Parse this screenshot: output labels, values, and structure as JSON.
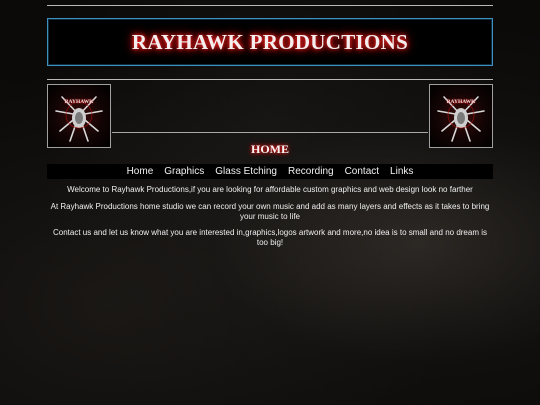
{
  "site": {
    "title": "RAYHAWK PRODUCTIONS",
    "accent_glow": "#d01010",
    "banner_border": "#3d90c0"
  },
  "logos": {
    "left": {
      "text": "RAYHAWK",
      "icon": "rayhawk-emblem"
    },
    "right": {
      "text": "RAYHAWK",
      "icon": "rayhawk-emblem"
    }
  },
  "page": {
    "heading": "HOME"
  },
  "nav": {
    "items": [
      {
        "label": "Home"
      },
      {
        "label": "Graphics"
      },
      {
        "label": "Glass Etching"
      },
      {
        "label": "Recording"
      },
      {
        "label": "Contact"
      },
      {
        "label": "Links"
      }
    ]
  },
  "content": {
    "paragraphs": [
      "Welcome to Rayhawk Productions,if you are looking for affordable custom graphics and web design look no farther",
      "At Rayhawk Productions home studio we can record your own music and add as many layers and effects as it takes to bring your music to life",
      "Contact us and let us know what you are interested in,graphics,logos artwork and more,no idea is to small and no dream is too big!"
    ]
  }
}
